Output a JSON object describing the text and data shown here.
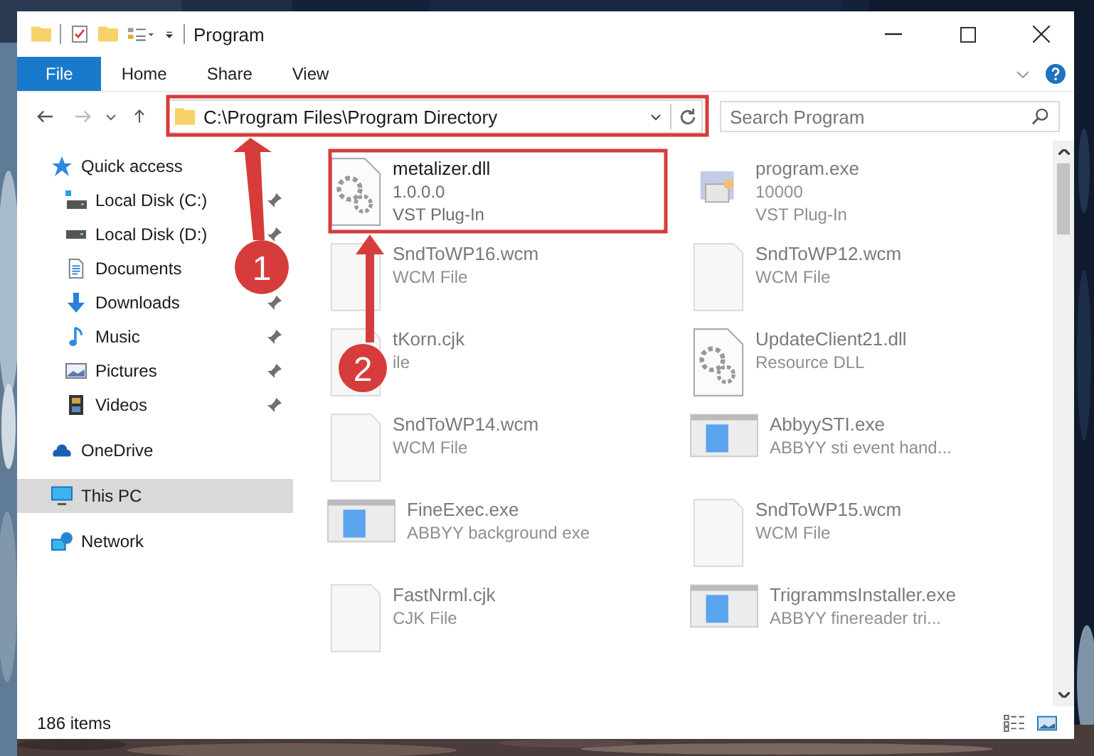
{
  "window": {
    "title": "Program"
  },
  "ribbon_tabs": [
    {
      "label": "File",
      "selected": true
    },
    {
      "label": "Home",
      "selected": false
    },
    {
      "label": "Share",
      "selected": false
    },
    {
      "label": "View",
      "selected": false
    }
  ],
  "address": {
    "path": "C:\\Program Files\\Program Directory"
  },
  "search": {
    "placeholder": "Search Program"
  },
  "sidebar": {
    "items": [
      {
        "label": "Quick access",
        "selected": false,
        "children": [
          {
            "label": "Local Disk (C:)",
            "pinned": true
          },
          {
            "label": "Local Disk (D:)",
            "pinned": true
          },
          {
            "label": "Documents",
            "pinned": false
          },
          {
            "label": "Downloads",
            "pinned": true
          },
          {
            "label": "Music",
            "pinned": true
          },
          {
            "label": "Pictures",
            "pinned": true
          },
          {
            "label": "Videos",
            "pinned": true
          }
        ]
      },
      {
        "label": "OneDrive",
        "selected": false
      },
      {
        "label": "This PC",
        "selected": true
      },
      {
        "label": "Network",
        "selected": false
      }
    ]
  },
  "files": [
    {
      "name": "metalizer.dll",
      "kind": "gears",
      "lines": [
        "1.0.0.0",
        "VST Plug-In"
      ]
    },
    {
      "name": "program.exe",
      "kind": "app",
      "lines": [
        "10000",
        "VST Plug-In"
      ]
    },
    {
      "name": "SndToWP16.wcm",
      "kind": "blank",
      "lines": [
        "WCM File"
      ]
    },
    {
      "name": "SndToWP12.wcm",
      "kind": "blank",
      "lines": [
        "WCM File"
      ]
    },
    {
      "name": "tKorn.cjk",
      "kind": "blank",
      "lines": [
        "ile"
      ]
    },
    {
      "name": "UpdateClient21.dll",
      "kind": "gears",
      "lines": [
        "Resource DLL"
      ]
    },
    {
      "name": "SndToWP14.wcm",
      "kind": "blank",
      "lines": [
        "WCM File"
      ]
    },
    {
      "name": "AbbyySTI.exe",
      "kind": "window",
      "lines": [
        "ABBYY sti event hand..."
      ]
    },
    {
      "name": "FineExec.exe",
      "kind": "window",
      "lines": [
        "ABBYY background exe"
      ]
    },
    {
      "name": "SndToWP15.wcm",
      "kind": "blank",
      "lines": [
        "WCM File"
      ]
    },
    {
      "name": "FastNrml.cjk",
      "kind": "blank",
      "lines": [
        "CJK File"
      ]
    },
    {
      "name": "TrigrammsInstaller.exe",
      "kind": "window",
      "lines": [
        "ABBYY finereader tri..."
      ]
    }
  ],
  "status_bar": {
    "count": "186 items"
  },
  "annotations": [
    {
      "label": "1",
      "kind": "address"
    },
    {
      "label": "2",
      "kind": "file"
    }
  ]
}
